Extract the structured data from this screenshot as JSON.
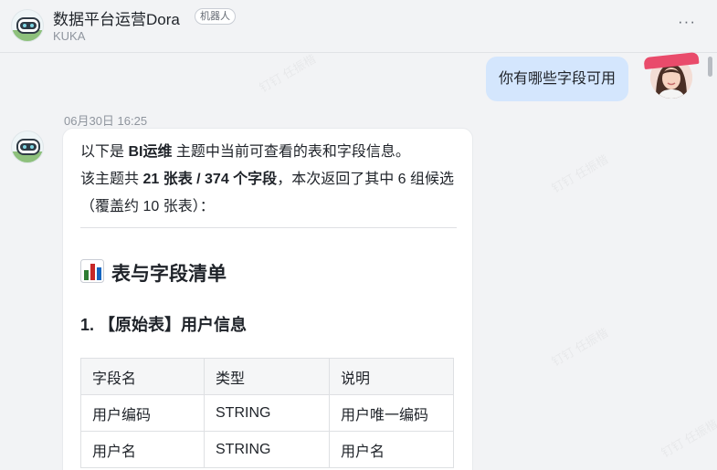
{
  "header": {
    "title": "数据平台运营Dora",
    "bot_tag": "机器人",
    "subtitle": "KUKA",
    "more_icon": "more-horizontal-icon"
  },
  "watermark": "钉钉 任振楷",
  "user_message": {
    "text": "你有哪些字段可用"
  },
  "bot_message": {
    "timestamp": "06月30日 16:25",
    "intro": {
      "p1": "以下是 ",
      "topic": "BI运维",
      "p2": " 主题中当前可查看的表和字段信息。",
      "p3": "该主题共 ",
      "counts": "21 张表 / 374 个字段",
      "p4": "，本次返回了其中 6 组候选（覆盖约 10 张表）："
    },
    "heading": "表与字段清单",
    "heading_icon": "bar-chart-icon",
    "section_title": "1. 【原始表】用户信息",
    "table": {
      "headers": [
        "字段名",
        "类型",
        "说明"
      ],
      "rows": [
        [
          "用户编码",
          "STRING",
          "用户唯一编码"
        ],
        [
          "用户名",
          "STRING",
          "用户名"
        ]
      ]
    }
  },
  "colors": {
    "background": "#f2f3f5",
    "user_bubble": "#d4e6fd",
    "card": "#ffffff",
    "table_header": "#f5f6f7"
  }
}
